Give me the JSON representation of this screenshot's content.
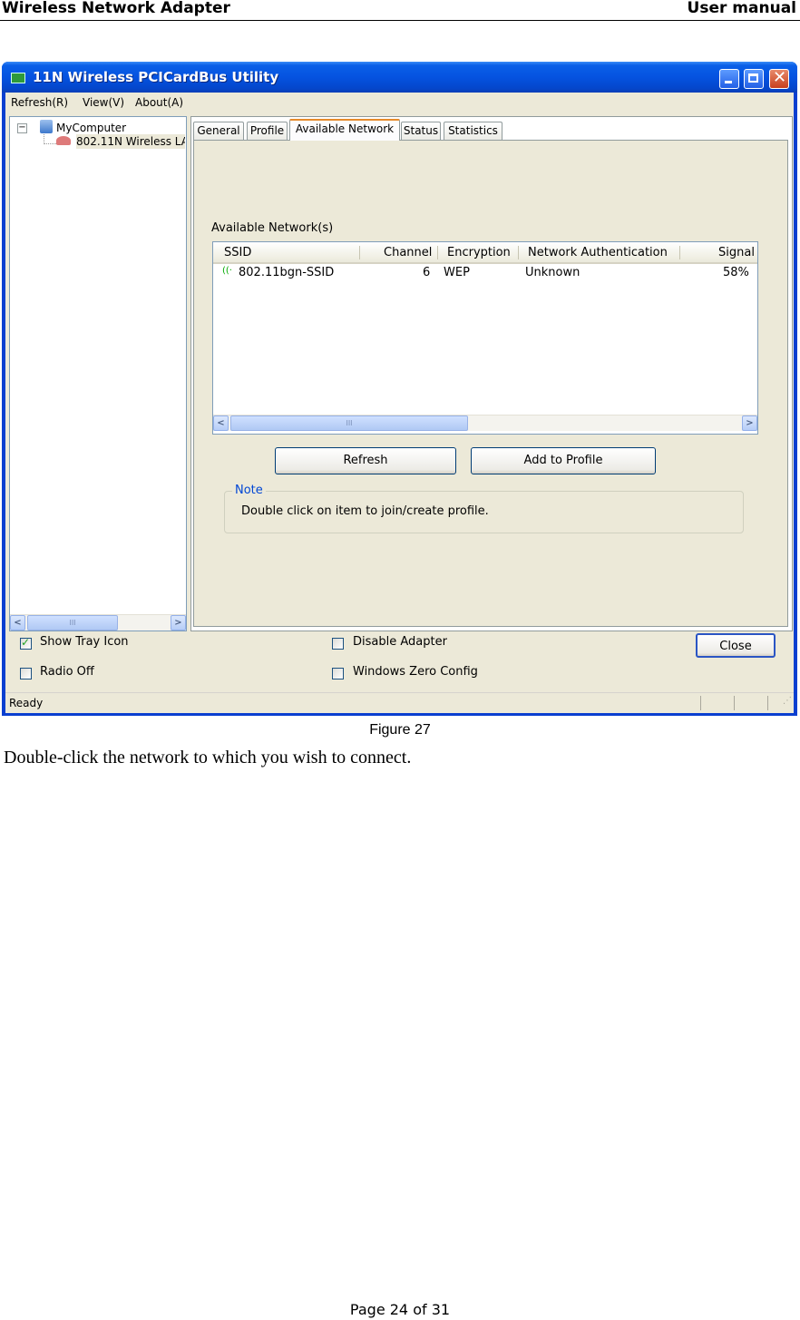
{
  "header": {
    "left": "Wireless Network Adapter",
    "right": "User manual"
  },
  "window": {
    "title": "11N Wireless PCICardBus Utility",
    "menu": [
      "Refresh(R)",
      "View(V)",
      "About(A)"
    ],
    "tree": {
      "root": "MyComputer",
      "child": "802.11N Wireless LA"
    },
    "tabs": [
      "General",
      "Profile",
      "Available Network",
      "Status",
      "Statistics"
    ],
    "active_tab": "Available Network",
    "section_label": "Available Network(s)",
    "columns": [
      "SSID",
      "Channel",
      "Encryption",
      "Network Authentication",
      "Signal"
    ],
    "rows": [
      {
        "ssid": "802.11bgn-SSID",
        "channel": "6",
        "encryption": "WEP",
        "auth": "Unknown",
        "signal": "58%"
      }
    ],
    "refresh_button": "Refresh",
    "add_profile_button": "Add to Profile",
    "note_title": "Note",
    "note_text": "Double click on item to join/create profile.",
    "show_tray_icon": "Show Tray Icon",
    "radio_off": "Radio Off",
    "disable_adapter": "Disable Adapter",
    "windows_zero_config": "Windows Zero Config",
    "close_button": "Close",
    "status": "Ready",
    "scroll_thumb": "III"
  },
  "caption": "Figure 27",
  "body_text": "Double-click the network to which you wish to connect.",
  "footer": "Page 24 of 31"
}
